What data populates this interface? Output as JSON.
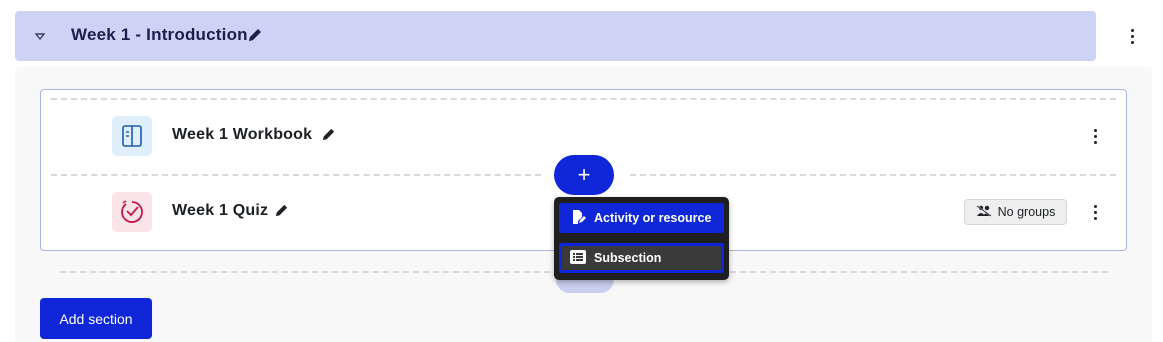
{
  "section": {
    "title": "Week 1 - Introduction",
    "toggle_icon": "chevron-down-icon",
    "edit_icon": "pencil-icon",
    "menu_icon": "kebab-menu-icon"
  },
  "activities": [
    {
      "name": "Week 1 Workbook",
      "type_icon": "book-icon",
      "icon_bg": "#deeefa",
      "icon_color": "#1f5aa6"
    },
    {
      "name": "Week 1 Quiz",
      "type_icon": "quiz-check-icon",
      "icon_bg": "#fbe3ea",
      "icon_color": "#c1184a",
      "groups_label": "No groups"
    }
  ],
  "add_button": {
    "label": "+"
  },
  "add_menu": {
    "items": [
      {
        "label": "Activity or resource",
        "icon": "document-edit-icon"
      },
      {
        "label": "Subsection",
        "icon": "list-icon"
      }
    ]
  },
  "add_section": {
    "label": "Add section"
  },
  "colors": {
    "header_bg": "#cdd3f4",
    "primary": "#0f27d8",
    "menu_bg": "#1f1f1f"
  }
}
